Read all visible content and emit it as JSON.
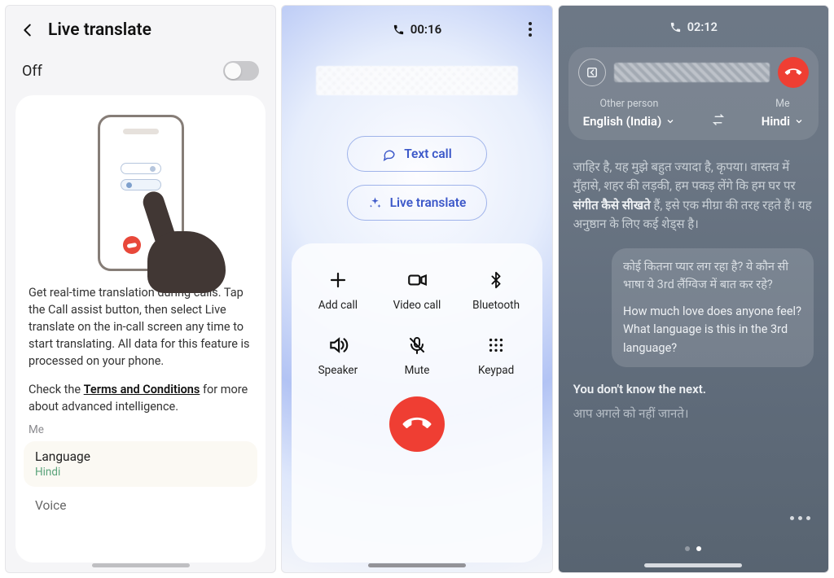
{
  "panel1": {
    "title": "Live translate",
    "state": "Off",
    "description": "Get real-time translation during calls. Tap the Call assist button, then select Live translate on the in-call screen any time to start translating. All data for this feature is processed on your phone.",
    "terms_prefix": "Check the ",
    "terms_link": "Terms and Conditions",
    "terms_suffix": " for more about advanced intelligence.",
    "me_label": "Me",
    "language_label": "Language",
    "language_value": "Hindi",
    "voice_label": "Voice"
  },
  "panel2": {
    "duration": "00:16",
    "text_call": "Text call",
    "live_translate": "Live translate",
    "grid": {
      "add_call": "Add call",
      "video_call": "Video call",
      "bluetooth": "Bluetooth",
      "speaker": "Speaker",
      "mute": "Mute",
      "keypad": "Keypad"
    }
  },
  "panel3": {
    "duration": "02:12",
    "other_label": "Other person",
    "other_lang": "English (India)",
    "me_label": "Me",
    "me_lang": "Hindi",
    "other_text_pre": "जाहिर है, यह मुझे बहुत ज्यादा है, कृपया। वास्तव में मुँहासे, शहर की लड़की, हम पकड़ लेंगे कि हम घर पर ",
    "other_text_bold": "संगीत कैसे सीखते",
    "other_text_post": " हैं, इसे एक मीग्रा की तरह रहते हैं। यह अनुष्ठान के लिए कई शेड्स है।",
    "me_src": "कोई कितना प्यार लग रहा है? ये कौन सी भाषा ये 3rd लैंग्विज में बात कर रहे?",
    "me_tr": "How much love does anyone feel? What language is this in the 3rd language?",
    "you_line": "You don't know the next.",
    "you_sub": "आप अगले को नहीं जानते।"
  }
}
